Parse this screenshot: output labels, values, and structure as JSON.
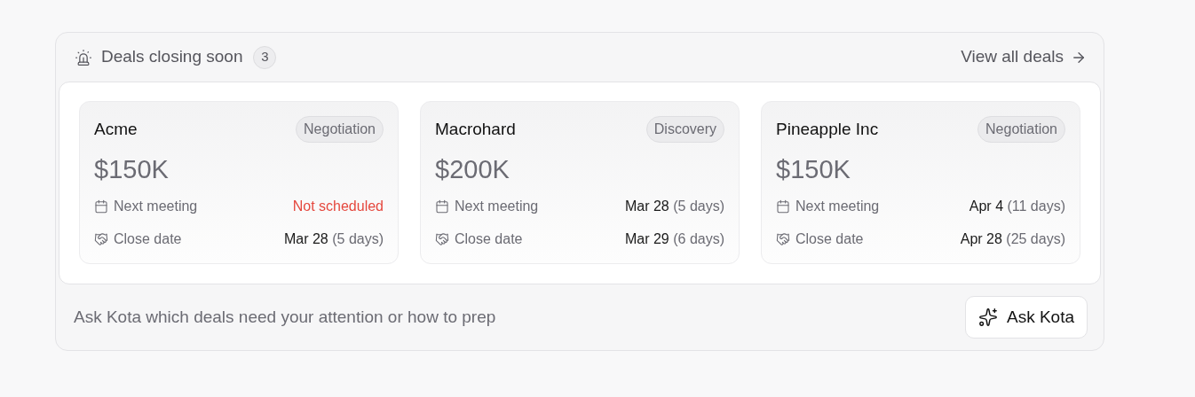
{
  "header": {
    "title": "Deals closing soon",
    "count": "3",
    "link": "View all deals"
  },
  "deals": [
    {
      "name": "Acme",
      "stage": "Negotiation",
      "amount": "$150K",
      "rows": [
        {
          "label": "Next meeting",
          "kind": "missing",
          "value": "Not scheduled"
        },
        {
          "label": "Close date",
          "kind": "date",
          "value": "Mar 28",
          "relative": "(5 days)"
        }
      ]
    },
    {
      "name": "Macrohard",
      "stage": "Discovery",
      "amount": "$200K",
      "rows": [
        {
          "label": "Next meeting",
          "kind": "date",
          "value": "Mar 28",
          "relative": "(5 days)"
        },
        {
          "label": "Close date",
          "kind": "date",
          "value": "Mar 29",
          "relative": "(6 days)"
        }
      ]
    },
    {
      "name": "Pineapple Inc",
      "stage": "Negotiation",
      "amount": "$150K",
      "rows": [
        {
          "label": "Next meeting",
          "kind": "date",
          "value": "Apr 4",
          "relative": "(11 days)"
        },
        {
          "label": "Close date",
          "kind": "date",
          "value": "Apr 28",
          "relative": "(25 days)"
        }
      ]
    }
  ],
  "footer": {
    "prompt": "Ask Kota which deals need your attention or how to prep",
    "button": "Ask Kota"
  }
}
